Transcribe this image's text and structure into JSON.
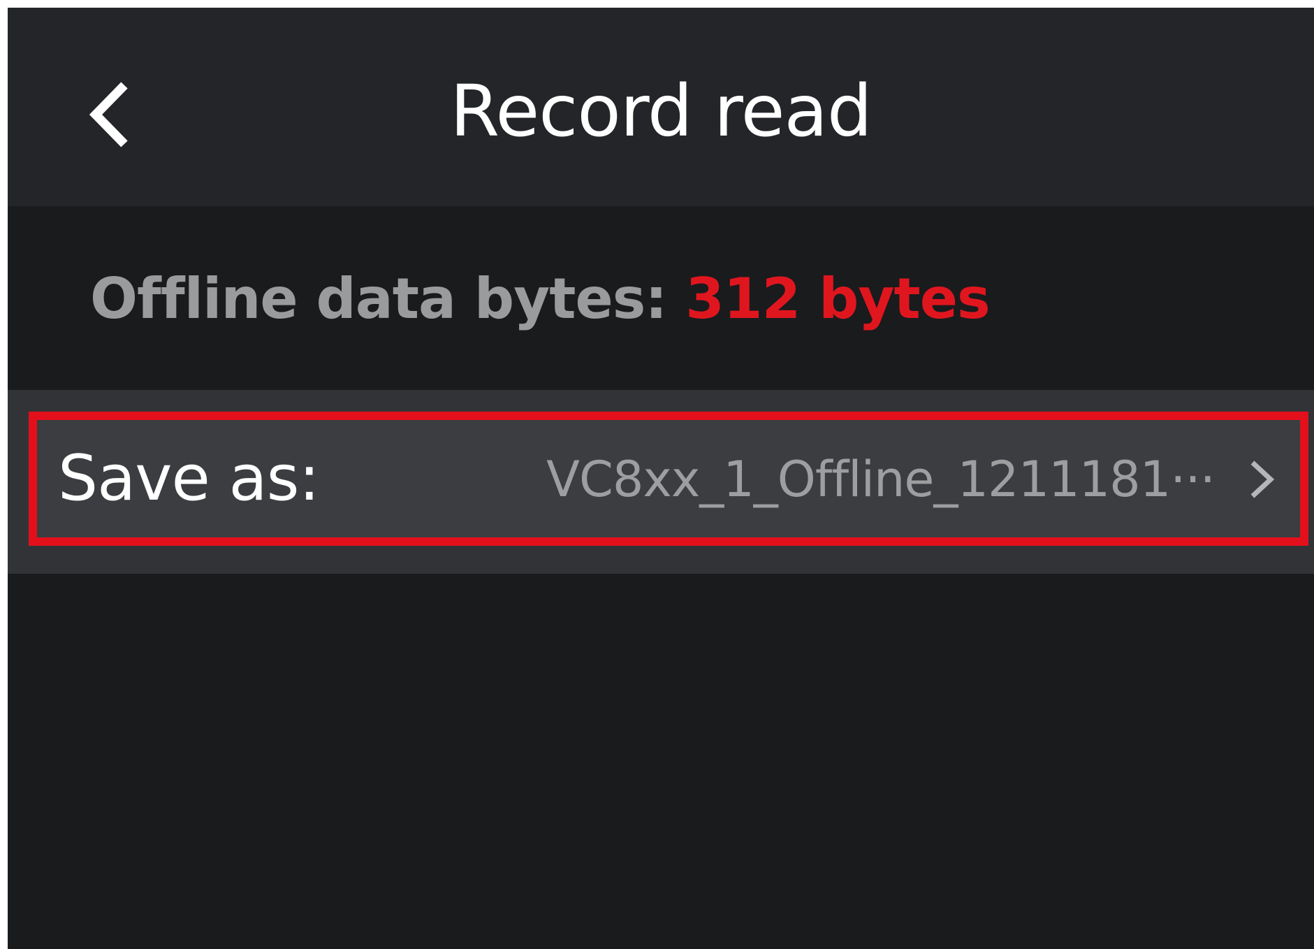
{
  "header": {
    "title": "Record read",
    "back_icon": "chevron-left-icon"
  },
  "info": {
    "label": "Offline data bytes: ",
    "value": "312 bytes"
  },
  "save": {
    "label": "Save as:",
    "value": "VC8xx_1_Offline_1211181···",
    "arrow_icon": "chevron-right-icon"
  },
  "colors": {
    "header_bg": "#232528",
    "screen_bg": "#1a1b1d",
    "row_bg": "#3b3d40",
    "highlight": "#e3101b",
    "value_accent": "#e0161f",
    "muted_text": "#9a9b9d"
  }
}
